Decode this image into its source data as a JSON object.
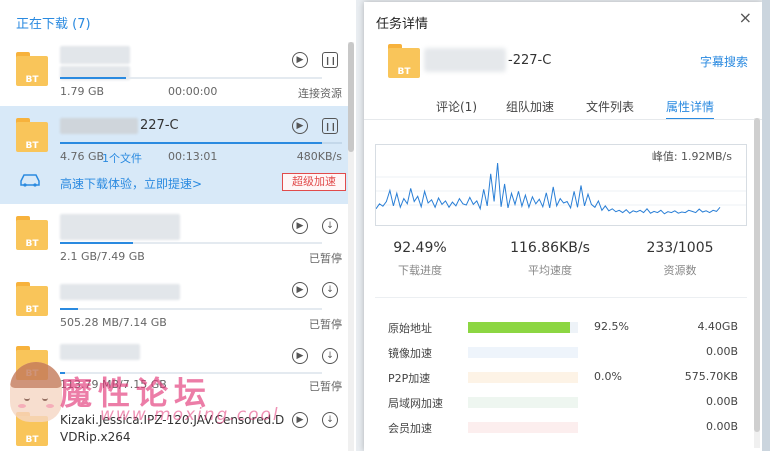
{
  "left": {
    "title": "正在下载 (7)",
    "items": [
      {
        "size": "1.79 GB",
        "time": "00:00:00",
        "status": "连接资源",
        "progress": 0.25
      },
      {
        "name_suffix": "227-C",
        "size": "4.76 GB",
        "files": "1个文件",
        "time": "00:13:01",
        "speed": "480KB/s",
        "boost_text": "高速下载体验，立即提速>",
        "boost_button": "超级加速",
        "progress": 0.93
      },
      {
        "size": "2.1 GB/7.49 GB",
        "status": "已暂停",
        "progress": 0.28
      },
      {
        "size": "505.28 MB/7.14 GB",
        "status": "已暂停",
        "progress": 0.07
      },
      {
        "size": "113.79 MB/7.15 GB",
        "status": "已暂停",
        "progress": 0.02
      },
      {
        "name": "Kizaki.Jessica.IPZ-120.JAV.Censored.DVDRip.x264"
      }
    ],
    "folder_badge": "BT",
    "watermark": {
      "text": "魔性论坛",
      "url": "www.moxing.cool"
    }
  },
  "panel": {
    "title": "任务详情",
    "close": "×",
    "name_suffix": "-227-C",
    "subtitle_link": "字幕搜索",
    "tabs": [
      "评论(1)",
      "组队加速",
      "文件列表",
      "属性详情"
    ],
    "active_tab": 3,
    "peak_label": "峰值: 1.92MB/s",
    "stats": [
      {
        "value": "92.49%",
        "label": "下载进度"
      },
      {
        "value": "116.86KB/s",
        "label": "平均速度"
      },
      {
        "value": "233/1005",
        "label": "资源数"
      }
    ],
    "sources": [
      {
        "label": "原始地址",
        "pct": "92.5%",
        "amount": "4.40GB",
        "fill": 0.925,
        "color": "#8cd642",
        "track": "#eef3f8"
      },
      {
        "label": "镜像加速",
        "pct": "",
        "amount": "0.00B",
        "fill": 0,
        "color": "#e8f1fb",
        "track": "#eef4fb"
      },
      {
        "label": "P2P加速",
        "pct": "0.0%",
        "amount": "575.70KB",
        "fill": 0,
        "color": "#fdeed8",
        "track": "#fdf3e6"
      },
      {
        "label": "局域网加速",
        "pct": "",
        "amount": "0.00B",
        "fill": 0,
        "color": "#e9f5ee",
        "track": "#eef6f0"
      },
      {
        "label": "会员加速",
        "pct": "",
        "amount": "0.00B",
        "fill": 0,
        "color": "#fbe8e8",
        "track": "#fceeee"
      }
    ]
  },
  "chart_data": {
    "type": "line",
    "title": "",
    "xlabel": "",
    "ylabel": "",
    "ylim": [
      0,
      1.92
    ],
    "series": [
      {
        "values": [
          0.35,
          0.52,
          0.44,
          0.6,
          0.98,
          0.45,
          0.88,
          0.4,
          0.7,
          0.52,
          1.05,
          0.6,
          0.78,
          0.42,
          0.95,
          0.55,
          0.66,
          0.4,
          0.72,
          0.5,
          0.62,
          0.4,
          0.58,
          0.45,
          0.7,
          0.52,
          0.48,
          0.74,
          0.5,
          0.62,
          0.35,
          1.02,
          0.45,
          1.55,
          0.6,
          1.92,
          0.42,
          1.2,
          0.38,
          0.88,
          0.5,
          0.95,
          0.44,
          0.82,
          0.4,
          0.76,
          0.52,
          0.68,
          0.42,
          0.9,
          0.38,
          1.1,
          0.45,
          0.7,
          0.55,
          0.6,
          0.38,
          0.95,
          0.4,
          1.15,
          0.45,
          0.85,
          0.5,
          0.4,
          0.62,
          0.3,
          0.45,
          0.28,
          0.35,
          0.25,
          0.3,
          0.22,
          0.32,
          0.2,
          0.28,
          0.24,
          0.3,
          0.22,
          0.35,
          0.2,
          0.26,
          0.22,
          0.3,
          0.18,
          0.25,
          0.22,
          0.28,
          0.2,
          0.24,
          0.22,
          0.3,
          0.26,
          0.22,
          0.34,
          0.24,
          0.28,
          0.22,
          0.3,
          0.26,
          0.4
        ]
      }
    ]
  }
}
